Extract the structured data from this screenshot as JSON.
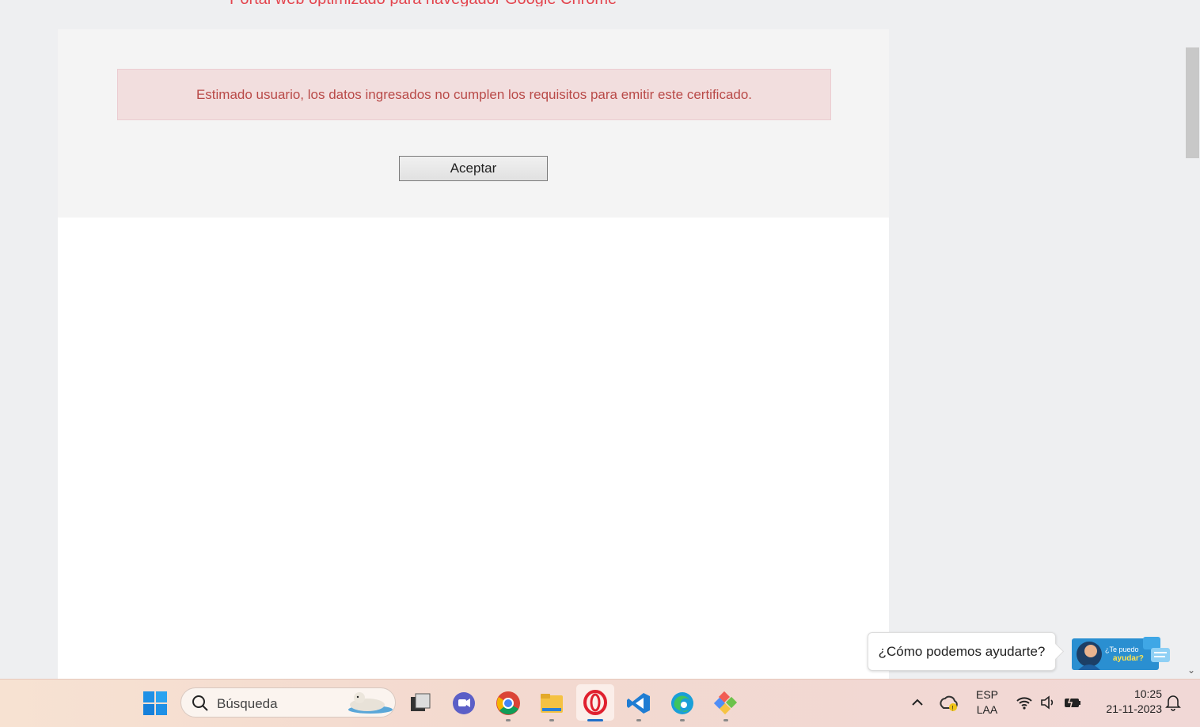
{
  "banner": {
    "text": "Portal web optimizado para navegador Google Chrome"
  },
  "alert": {
    "message": "Estimado usuario, los datos ingresados no cumplen los requisitos para emitir este certificado."
  },
  "form": {
    "accept_label": "Aceptar"
  },
  "chat": {
    "prompt": "¿Cómo podemos ayudarte?",
    "widget_text_1": "¿Te puedo",
    "widget_text_2": "ayudar?"
  },
  "taskbar": {
    "search_placeholder": "Búsqueda",
    "language_top": "ESP",
    "language_bottom": "LAA",
    "time": "10:25",
    "date": "21-11-2023"
  },
  "colors": {
    "alert_text": "#b94a48",
    "alert_bg": "#f2dede",
    "banner_text": "#e3454e"
  }
}
